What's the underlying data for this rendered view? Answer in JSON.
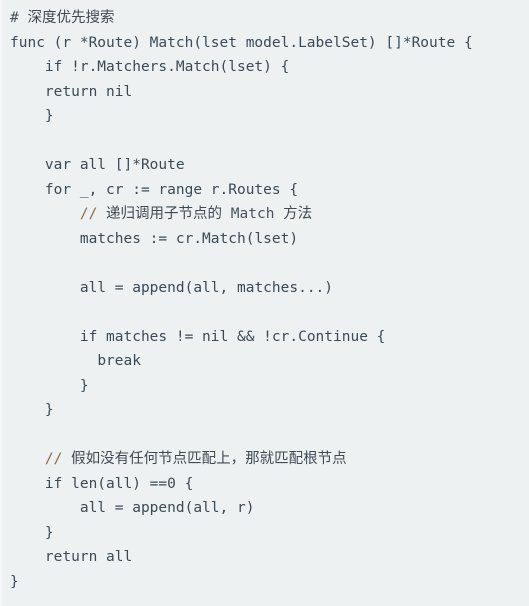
{
  "document": {
    "language": "go",
    "background_color": "#eef1f2",
    "text_color": "#3a4a57",
    "comment_color": "#49535c",
    "slash_color": "#8a6a44",
    "title_comment": "# 深度优先搜索"
  },
  "code": {
    "lines": [
      {
        "indent": 0,
        "text": "# 深度优先搜索",
        "kind": "comment-hash"
      },
      {
        "indent": 0,
        "text": "func (r *Route) Match(lset model.LabelSet) []*Route {",
        "kind": "code"
      },
      {
        "indent": 4,
        "text": "if !r.Matchers.Match(lset) {",
        "kind": "code"
      },
      {
        "indent": 4,
        "text": "return nil",
        "kind": "code"
      },
      {
        "indent": 4,
        "text": "}",
        "kind": "code"
      },
      {
        "indent": 0,
        "text": "",
        "kind": "blank"
      },
      {
        "indent": 4,
        "text": "var all []*Route",
        "kind": "code"
      },
      {
        "indent": 4,
        "text": "for _, cr := range r.Routes {",
        "kind": "code"
      },
      {
        "indent": 8,
        "text": "// 递归调用子节点的 Match 方法",
        "kind": "comment-slash"
      },
      {
        "indent": 8,
        "text": "matches := cr.Match(lset)",
        "kind": "code"
      },
      {
        "indent": 0,
        "text": "",
        "kind": "blank"
      },
      {
        "indent": 8,
        "text": "all = append(all, matches...)",
        "kind": "code"
      },
      {
        "indent": 0,
        "text": "",
        "kind": "blank"
      },
      {
        "indent": 8,
        "text": "if matches != nil && !cr.Continue {",
        "kind": "code"
      },
      {
        "indent": 10,
        "text": "break",
        "kind": "code"
      },
      {
        "indent": 8,
        "text": "}",
        "kind": "code"
      },
      {
        "indent": 4,
        "text": "}",
        "kind": "code"
      },
      {
        "indent": 0,
        "text": "",
        "kind": "blank"
      },
      {
        "indent": 4,
        "text": "// 假如没有任何节点匹配上，那就匹配根节点",
        "kind": "comment-slash"
      },
      {
        "indent": 4,
        "text": "if len(all) ==0 {",
        "kind": "code"
      },
      {
        "indent": 8,
        "text": "all = append(all, r)",
        "kind": "code"
      },
      {
        "indent": 4,
        "text": "}",
        "kind": "code"
      },
      {
        "indent": 4,
        "text": "return all",
        "kind": "code"
      },
      {
        "indent": 0,
        "text": "}",
        "kind": "code"
      }
    ]
  }
}
